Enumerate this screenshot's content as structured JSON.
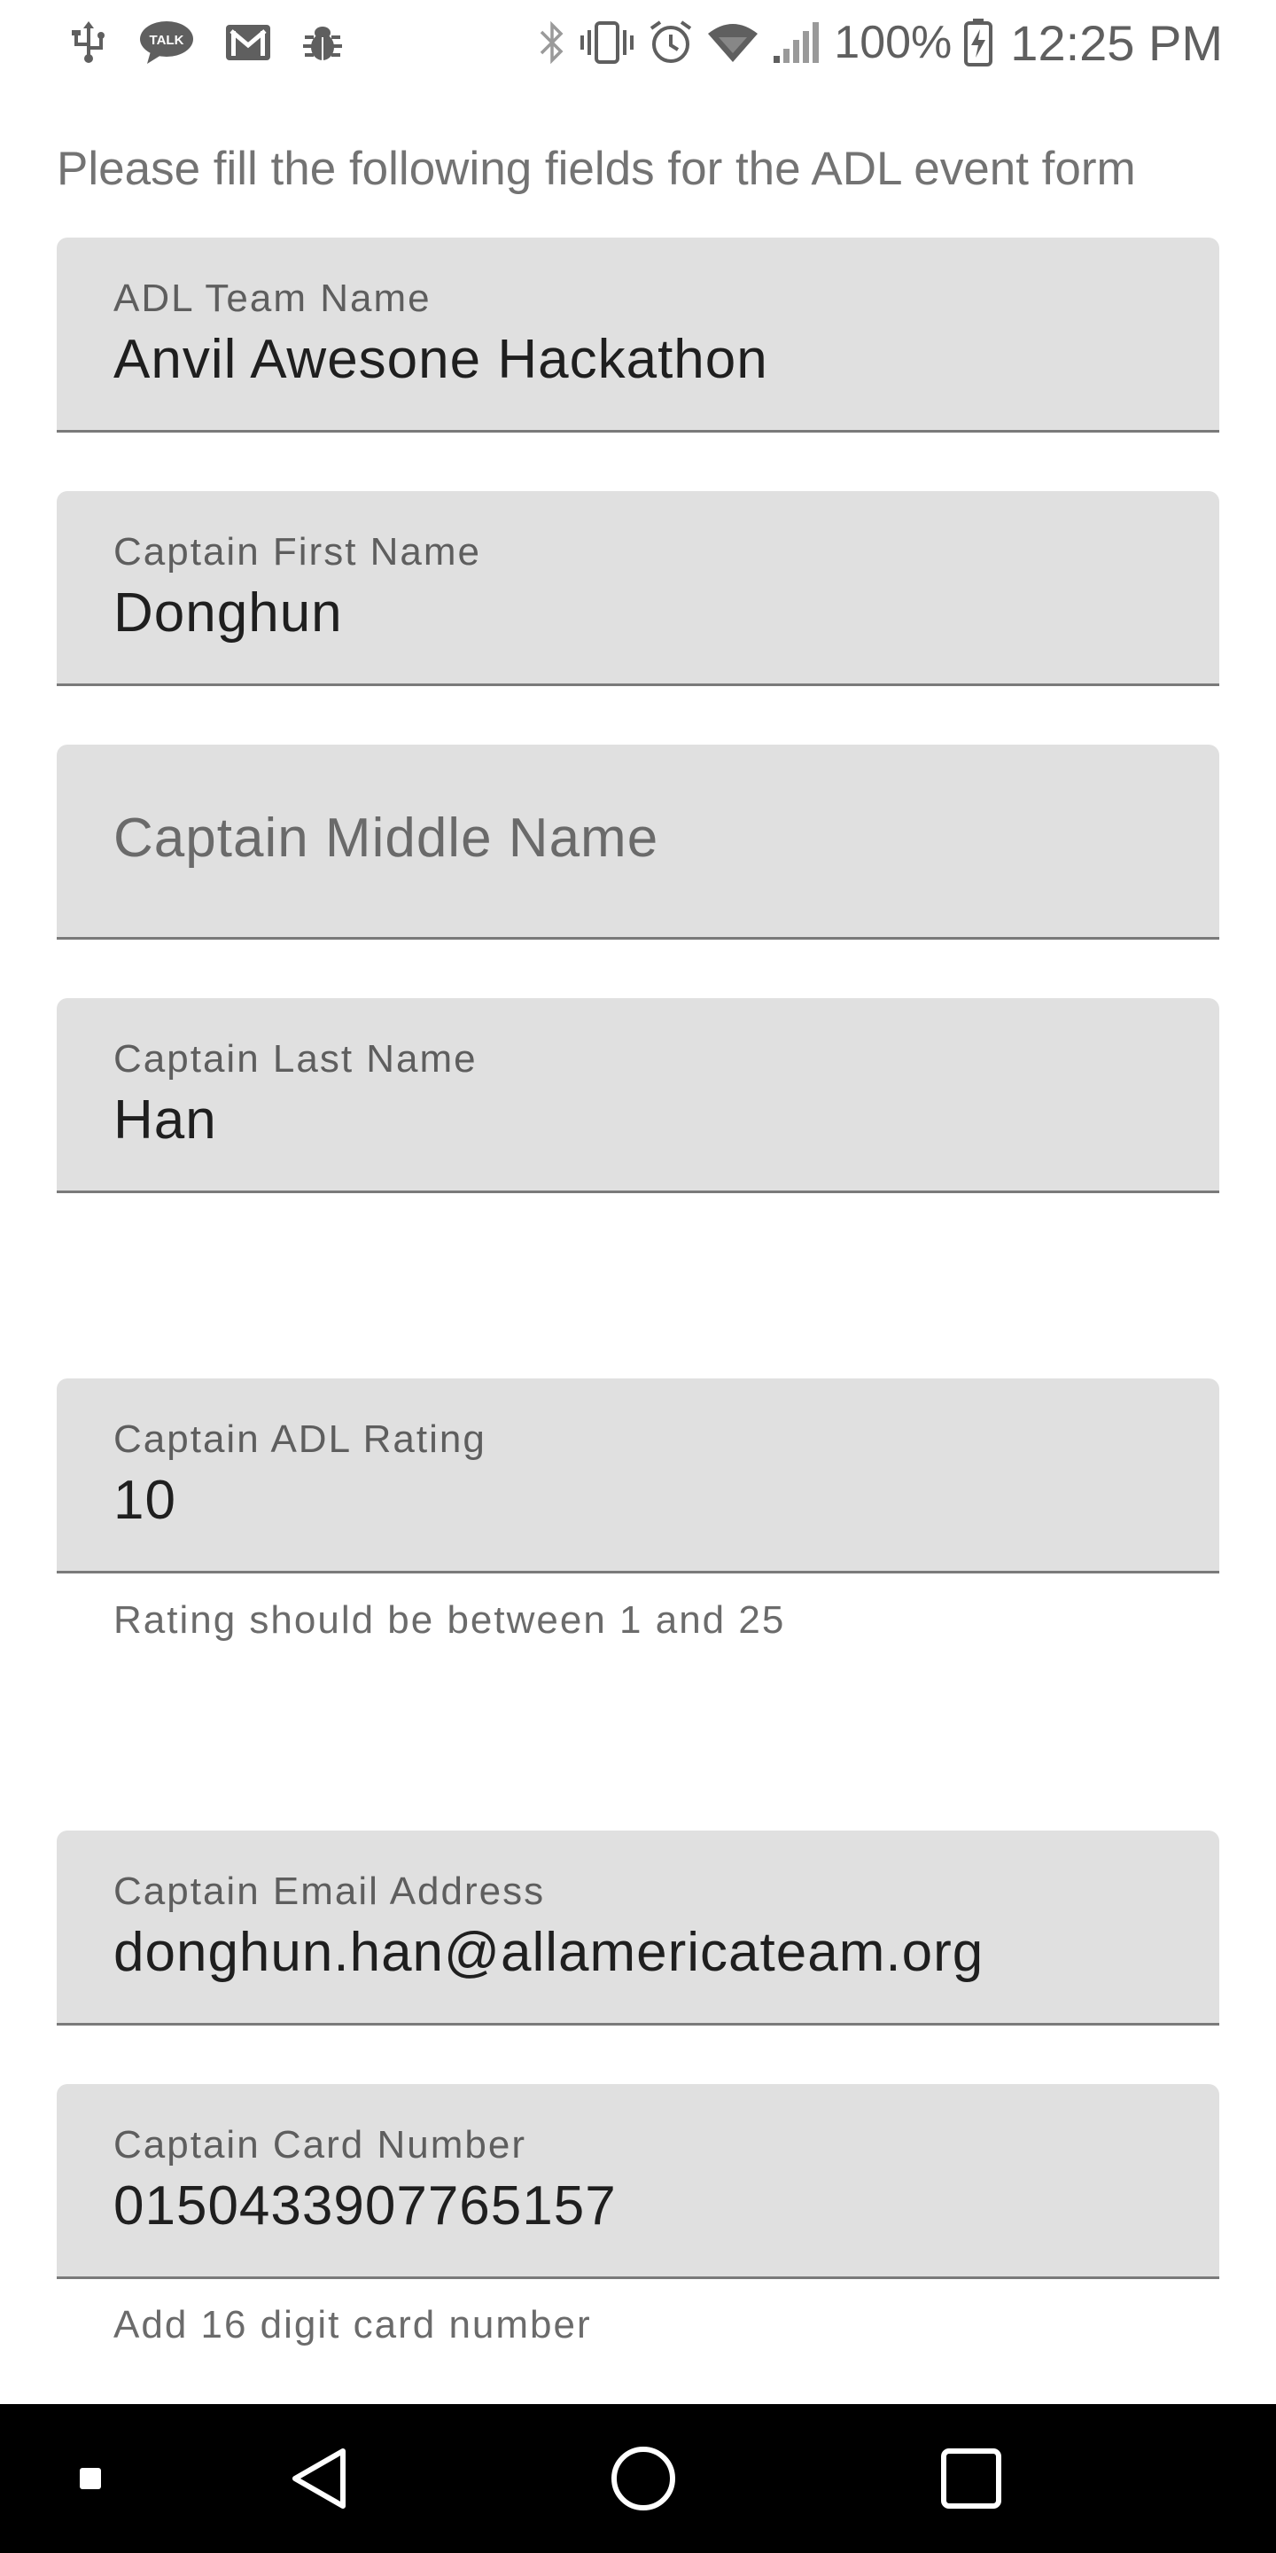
{
  "status_bar": {
    "icons_left": [
      "usb-icon",
      "talk-icon",
      "gmail-icon",
      "bug-icon"
    ],
    "icons_right": [
      "bluetooth-icon",
      "vibrate-icon",
      "alarm-icon",
      "wifi-icon",
      "signal-icon"
    ],
    "battery": "100%",
    "time": "12:25 PM"
  },
  "form": {
    "prompt": "Please fill the following fields for the ADL event form",
    "fields": [
      {
        "label": "ADL Team Name",
        "value": "Anvil Awesone Hackathon"
      },
      {
        "label": "Captain First Name",
        "value": "Donghun"
      },
      {
        "placeholder": "Captain Middle Name"
      },
      {
        "label": "Captain Last Name",
        "value": "Han"
      },
      {
        "label": "Captain ADL Rating",
        "value": "10",
        "helper": "Rating should be between 1 and 25"
      },
      {
        "label": "Captain Email Address",
        "value": "donghun.han@allamericateam.org"
      },
      {
        "label": "Captain Card Number",
        "value": "0150433907765157",
        "helper": "Add 16 digit card number"
      }
    ]
  },
  "nav_bar": {
    "icons": [
      "recents-dot-icon",
      "back-icon",
      "home-icon",
      "overview-icon"
    ]
  },
  "colors": {
    "field_bg": "#e0e0e0",
    "nav_bg": "#000000"
  }
}
